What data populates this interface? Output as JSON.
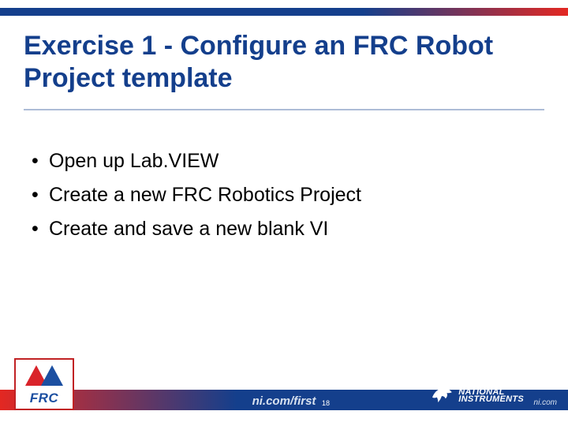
{
  "title": "Exercise 1 -  Configure an FRC Robot Project template",
  "bullets": [
    "Open up Lab.VIEW",
    "Create a new FRC Robotics Project",
    "Create and save a new blank VI"
  ],
  "footer": {
    "center_text": "ni.com/first",
    "page_number": "18",
    "right_url": "ni.com"
  },
  "frc_label": "FRC",
  "ni_logo": {
    "line1": "NATIONAL",
    "line2": "INSTRUMENTS"
  }
}
